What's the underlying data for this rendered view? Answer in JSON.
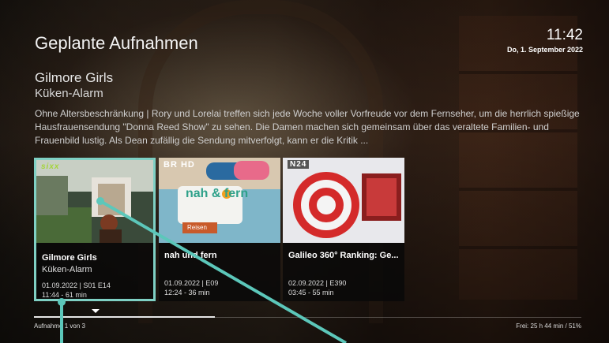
{
  "header": {
    "title": "Geplante Aufnahmen",
    "time": "11:42",
    "date": "Do, 1. September 2022"
  },
  "detail": {
    "show_title": "Gilmore Girls",
    "episode_title": "Küken-Alarm",
    "description": "Ohne Altersbeschränkung | Rory und Lorelai treffen sich jede Woche voller Vorfreude vor dem Fernseher, um die herrlich spießige Hausfrauensendung \"Donna Reed Show\" zu sehen. Die Damen machen sich gemeinsam über das veraltete Familien- und Frauenbild lustig. Als Dean zufällig die Sendung mitverfolgt, kann er die Kritik ..."
  },
  "recordings": [
    {
      "channel_logo": "sixx",
      "title": "Gilmore Girls",
      "subtitle": "Küken-Alarm",
      "meta1": "01.09.2022 | S01 E14",
      "meta2": "11:44 - 61 min",
      "selected": true
    },
    {
      "channel_logo": "BR HD",
      "title": "nah und fern",
      "subtitle": "",
      "meta1": "01.09.2022 | E09",
      "meta2": "12:24 - 36 min",
      "selected": false,
      "thumb_text": "nah & fern",
      "thumb_tag": "Reisen"
    },
    {
      "channel_logo": "N24",
      "title": "Galileo 360° Ranking: Ge...",
      "subtitle": "",
      "meta1": "02.09.2022 | E390",
      "meta2": "03:45 - 55 min",
      "selected": false
    }
  ],
  "footer": {
    "counter": "Aufnahme 1 von 3",
    "free_space": "Frei: 25 h 44 min / 51%",
    "progress_fraction": 0.33
  },
  "colors": {
    "accent": "#7fd0c4",
    "sixx_logo": "#a4d43a"
  }
}
